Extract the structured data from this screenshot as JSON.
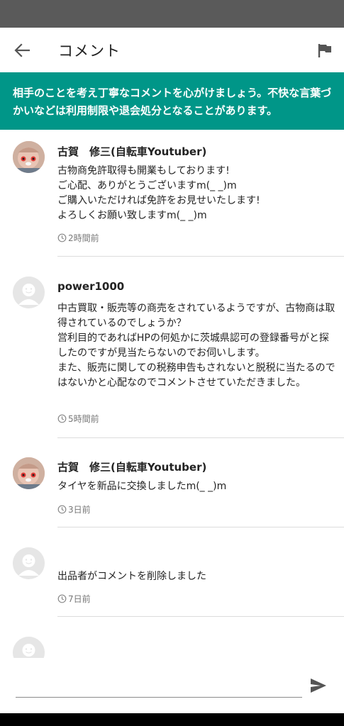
{
  "app_bar": {
    "title": "コメント"
  },
  "notice": {
    "text": "相手のことを考え丁寧なコメントを心がけましょう。不快な言葉づかいなどは利用制限や退会処分となることがあります。"
  },
  "comments": [
    {
      "name": "古賀　修三(自転車Youtuber)",
      "lines": [
        "古物商免許取得も開業もしております!",
        "ご心配、ありがとうございますm(_ _)m",
        "ご購入いただければ免許をお見せいたします!",
        "よろしくお願い致しますm(_ _)m"
      ],
      "time": "2時間前"
    },
    {
      "name": "power1000",
      "lines": [
        "中古買取・販売等の商売をされているようですが、古物商は取得されているのでしょうか？",
        "営利目的であればHPの何処かに茨城県認可の登録番号がと探したのですが見当たらないのでお伺いします。",
        "また、販売に関しての税務申告もされないと脱税に当たるのではないかと心配なのでコメントさせていただきました。"
      ],
      "time": "5時間前"
    },
    {
      "name": "古賀　修三(自転車Youtuber)",
      "lines": [
        "タイヤを新品に交換しましたm(_ _)m"
      ],
      "time": "3日前"
    },
    {
      "name": "",
      "lines": [
        "出品者がコメントを削除しました"
      ],
      "time": "7日前"
    }
  ],
  "input": {
    "value": "",
    "placeholder": ""
  },
  "icons": {
    "back": "arrow-back-icon",
    "flag": "flag-icon",
    "clock": "clock-icon",
    "send": "send-icon",
    "default_avatar": "default-avatar-icon"
  },
  "colors": {
    "notice_bg": "#009688",
    "status_bar": "#5a5a5a",
    "divider": "#dcdcdc"
  }
}
